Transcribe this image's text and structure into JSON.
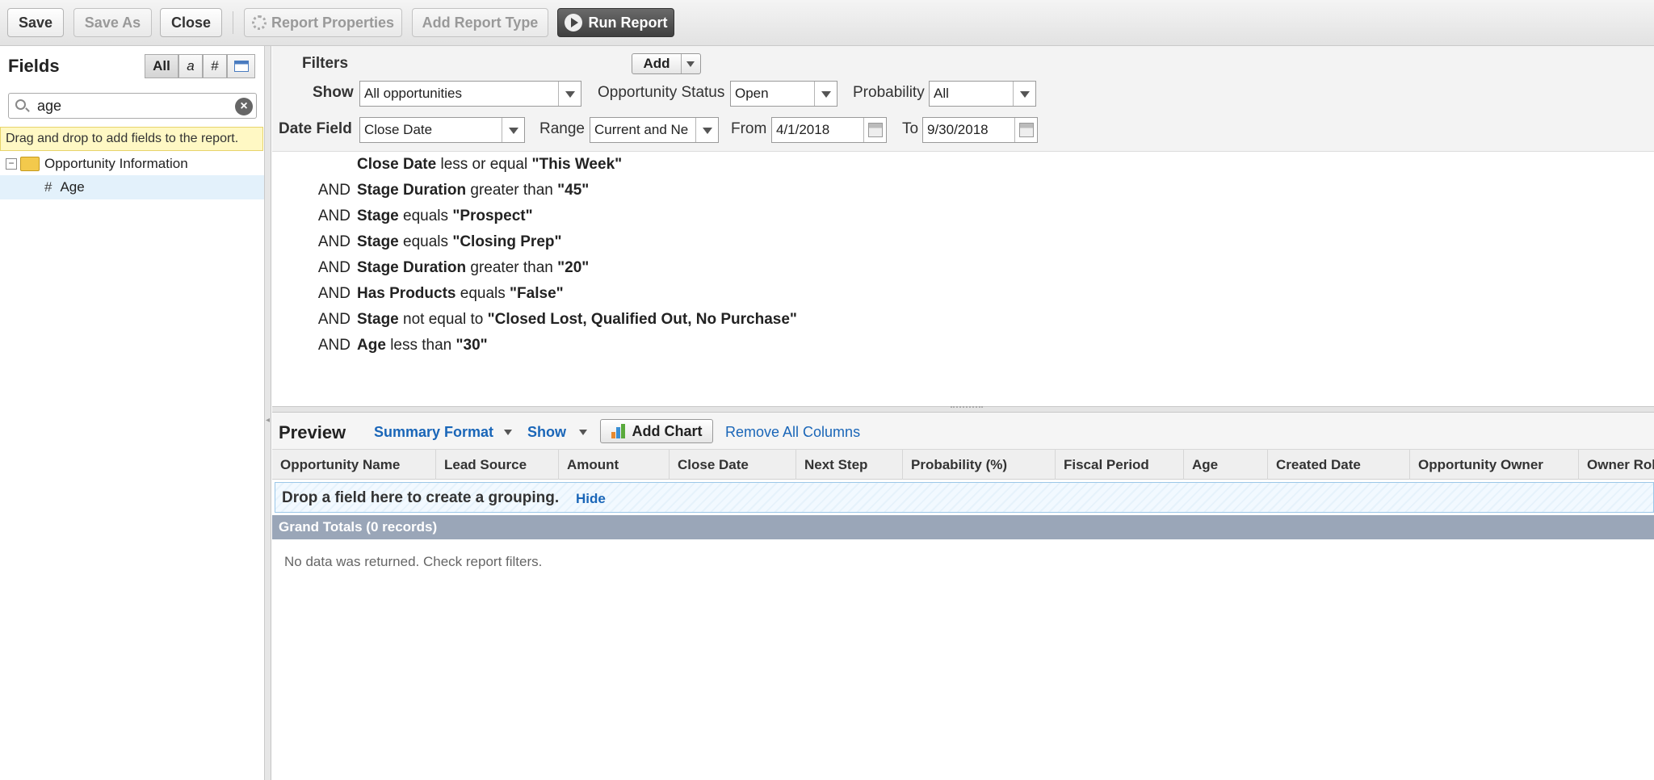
{
  "toolbar": {
    "save": "Save",
    "save_as": "Save As",
    "close": "Close",
    "report_properties": "Report Properties",
    "add_report_type": "Add Report Type",
    "run_report": "Run Report"
  },
  "fields_panel": {
    "title": "Fields",
    "type_filters": [
      "All",
      "a",
      "#",
      ""
    ],
    "search_value": "age",
    "hint": "Drag and drop to add fields to the report.",
    "tree": {
      "folder": "Opportunity Information",
      "items": [
        {
          "type": "#",
          "label": "Age"
        }
      ]
    }
  },
  "filters": {
    "filters_label": "Filters",
    "add_label": "Add",
    "show_label": "Show",
    "show_value": "All opportunities",
    "status_label": "Opportunity Status",
    "status_value": "Open",
    "probability_label": "Probability",
    "probability_value": "All",
    "date_field_label": "Date Field",
    "date_field_value": "Close Date",
    "range_label": "Range",
    "range_value": "Current and Ne",
    "from_label": "From",
    "from_value": "4/1/2018",
    "to_label": "To",
    "to_value": "9/30/2018"
  },
  "filter_logic": [
    {
      "op": "",
      "field": "Close Date",
      "cond": "less or equal",
      "value": "\"This Week\""
    },
    {
      "op": "AND",
      "field": "Stage Duration",
      "cond": "greater than",
      "value": "\"45\""
    },
    {
      "op": "AND",
      "field": "Stage",
      "cond": "equals",
      "value": "\"Prospect\""
    },
    {
      "op": "AND",
      "field": "Stage",
      "cond": "equals",
      "value": "\"Closing Prep\""
    },
    {
      "op": "AND",
      "field": "Stage Duration",
      "cond": "greater than",
      "value": "\"20\""
    },
    {
      "op": "AND",
      "field": "Has Products",
      "cond": "equals",
      "value": "\"False\""
    },
    {
      "op": "AND",
      "field": "Stage",
      "cond": "not equal to",
      "value": "\"Closed Lost, Qualified Out, No Purchase\""
    },
    {
      "op": "AND",
      "field": "Age",
      "cond": "less than",
      "value": "\"30\""
    }
  ],
  "preview": {
    "title": "Preview",
    "format_label": "Summary Format",
    "show_label": "Show",
    "add_chart": "Add Chart",
    "remove_columns": "Remove All Columns",
    "columns": [
      "Opportunity Name",
      "Lead Source",
      "Amount",
      "Close Date",
      "Next Step",
      "Probability (%)",
      "Fiscal Period",
      "Age",
      "Created Date",
      "Opportunity Owner",
      "Owner Rol"
    ],
    "drop_message": "Drop a field here to create a grouping.",
    "hide_label": "Hide",
    "grand_totals": "Grand Totals (0 records)",
    "no_data": "No data was returned. Check report filters."
  }
}
